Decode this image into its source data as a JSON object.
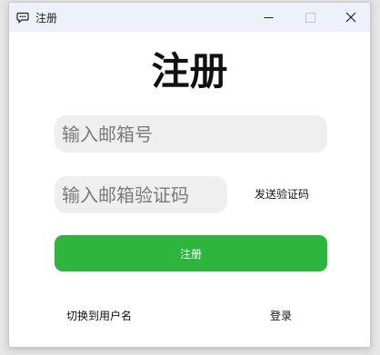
{
  "window": {
    "title": "注册",
    "icons": {
      "app": "chat-bubble-icon",
      "minimize": "minimize-icon",
      "maximize": "maximize-icon",
      "close": "close-icon"
    }
  },
  "form": {
    "heading": "注册",
    "email_placeholder": "输入邮箱号",
    "code_placeholder": "输入邮箱验证码",
    "send_code_label": "发送验证码",
    "submit_label": "注册"
  },
  "footer": {
    "switch_label": "切换到用户名",
    "login_label": "登录"
  },
  "colors": {
    "titlebar": "#eef1f9",
    "primary": "#2db53e",
    "input_bg": "#efefef"
  }
}
